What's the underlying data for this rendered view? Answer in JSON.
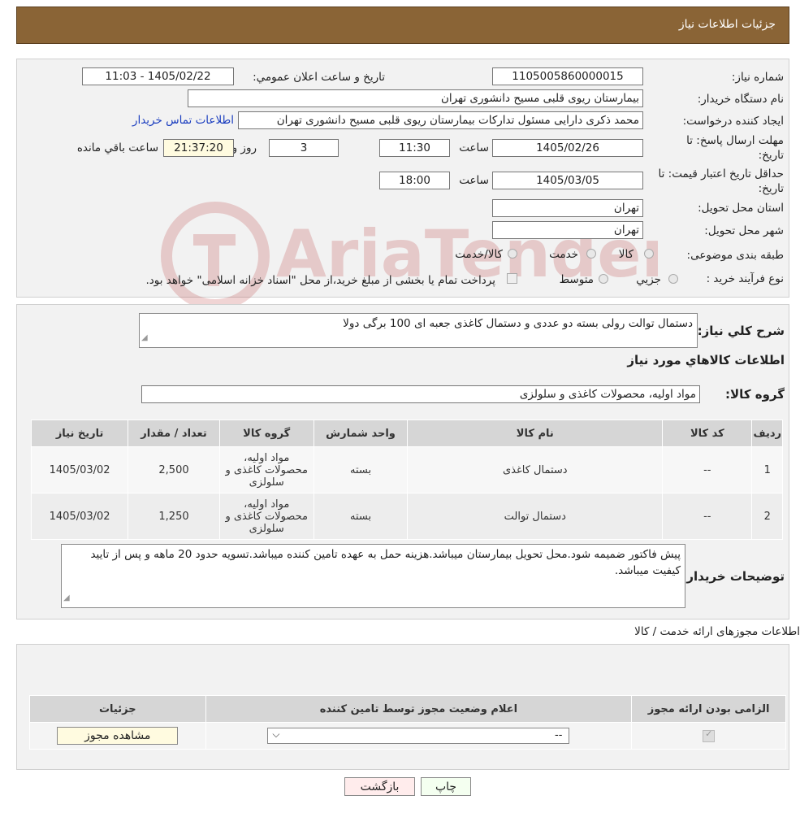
{
  "header": {
    "title": "جزئیات اطلاعات نیاز"
  },
  "form": {
    "need_number": {
      "label": "شماره نیاز:",
      "value": "1105005860000015"
    },
    "announce_datetime": {
      "label": "تاریخ و ساعت اعلان عمومي:",
      "value": "1405/02/22 - 11:03"
    },
    "buyer_org": {
      "label": "نام دستگاه خريدار:",
      "value": "بیمارستان ریوی قلبی مسیح دانشوری تهران"
    },
    "requester": {
      "label": "ایجاد کننده درخواست:",
      "value": "محمد ذکری دارایی مسئول تدارکات بیمارستان ریوی قلبی مسیح دانشوری تهران",
      "contact_link": "اطلاعات تماس خریدار"
    },
    "response_deadline": {
      "label_line1": "مهلت ارسال پاسخ: تا",
      "label_line2": "تاریخ:",
      "date": "1405/02/26",
      "time_label": "ساعت",
      "time": "11:30",
      "days": "3",
      "days_label": "روز و",
      "remaining": "21:37:20",
      "remaining_label": "ساعت باقي مانده"
    },
    "price_validity": {
      "label_line1": "حداقل تاریخ اعتبار قیمت: تا",
      "label_line2": "تاریخ:",
      "date": "1405/03/05",
      "time_label": "ساعت",
      "time": "18:00"
    },
    "delivery_province": {
      "label": "استان محل تحویل:",
      "value": "تهران"
    },
    "delivery_city": {
      "label": "شهر محل تحویل:",
      "value": "تهران"
    },
    "category": {
      "label": "طبقه بندی موضوعی:",
      "options": [
        "کالا",
        "خدمت",
        "کالا/خدمت"
      ]
    },
    "purchase_type": {
      "label": "نوع فرآیند خرید :",
      "options": [
        "جزیي",
        "متوسط"
      ],
      "note": "پرداخت تمام یا بخشی از مبلغ خرید،از محل \"اسناد خزانه اسلامی\" خواهد بود."
    }
  },
  "summary": {
    "label": "شرح کلي نياز:",
    "value": "دستمال توالت رولی بسته دو عددی و دستمال کاغذی جعبه ای 100 برگی دولا",
    "goods_info_title": "اطلاعات کالاهاي مورد نياز",
    "goods_group_label": "گروه کالا:",
    "goods_group_value": "مواد اولیه، محصولات کاغذی و سلولزی"
  },
  "goods_table": {
    "headers": [
      "رديف",
      "کد کالا",
      "نام کالا",
      "واحد شمارش",
      "گروه کالا",
      "تعداد / مقدار",
      "تاریخ نیاز"
    ],
    "rows": [
      {
        "row": "1",
        "code": "--",
        "name": "دستمال کاغذی",
        "unit": "بسته",
        "group": "مواد اولیه، محصولات کاغذی و سلولزی",
        "qty": "2,500",
        "date": "1405/03/02"
      },
      {
        "row": "2",
        "code": "--",
        "name": "دستمال توالت",
        "unit": "بسته",
        "group": "مواد اولیه، محصولات کاغذی و سلولزی",
        "qty": "1,250",
        "date": "1405/03/02"
      }
    ]
  },
  "buyer_notes": {
    "label": "توضیحات خریدار:",
    "value": "پیش فاکتور ضمیمه شود.محل تحویل بیمارستان میباشد.هزینه حمل به عهده تامین کننده میباشد.تسویه حدود 20 ماهه و پس از تایید کیفیت میباشد."
  },
  "license_section": {
    "title": "اطلاعات مجوزهای ارائه خدمت / کالا",
    "headers": [
      "الزامی بودن ارائه مجوز",
      "اعلام وضعیت مجوز توسط تامین کننده",
      "جزئیات"
    ],
    "select_value": "--",
    "view_button": "مشاهده مجوز"
  },
  "actions": {
    "print": "چاپ",
    "back": "بازگشت"
  },
  "watermark": {
    "text": "AriaTender.neT"
  },
  "colors": {
    "header_bg": "#8a6436",
    "link": "#1a3dbf",
    "yellow_field": "#fffbe0"
  }
}
